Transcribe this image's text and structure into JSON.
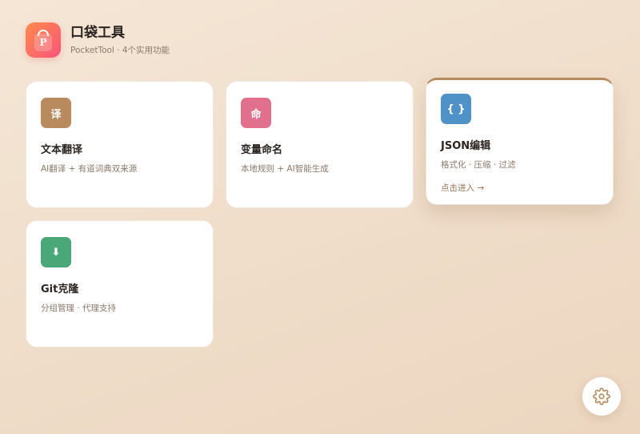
{
  "app": {
    "title": "口袋工具",
    "subtitle": "PocketTool · 4个实用功能",
    "logo_letter": "P"
  },
  "cards": [
    {
      "icon_text": "译",
      "icon_name": "translate-icon",
      "title": "文本翻译",
      "desc": "AI翻译 + 有道词典双来源",
      "color": "#b98a5e"
    },
    {
      "icon_text": "命",
      "icon_name": "naming-icon",
      "title": "变量命名",
      "desc": "本地规则 + AI智能生成",
      "color": "#e0708e"
    },
    {
      "icon_text": "{ }",
      "icon_name": "braces-icon",
      "title": "JSON编辑",
      "desc": "格式化 · 压缩 · 过滤",
      "link": "点击进入 →",
      "color": "#4e92c7"
    },
    {
      "icon_text": "⬇",
      "icon_name": "download-icon",
      "title": "Git克隆",
      "desc": "分组管理 · 代理支持",
      "color": "#4aa878"
    }
  ],
  "colors": {
    "accent": "#b98a5e",
    "logo_start": "#ff8a4c",
    "logo_end": "#f7557a"
  },
  "settings": {
    "icon_name": "gear-icon"
  }
}
